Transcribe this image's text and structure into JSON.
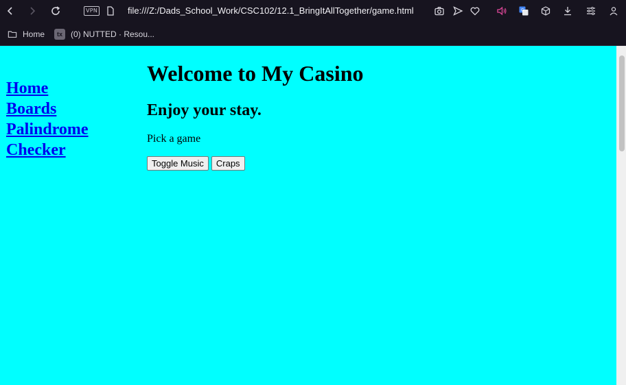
{
  "browser": {
    "vpn_label": "VPN",
    "url": "file:///Z:/Dads_School_Work/CSC102/12.1_BringItAllTogether/game.html",
    "bookmarks": [
      {
        "label": "Home",
        "icon": "folder-icon"
      },
      {
        "label": "(0) NUTTED · Resou...",
        "icon": "tx-favicon",
        "favicon_text": "tx"
      }
    ]
  },
  "page": {
    "background": "#00ffff",
    "nav_links": [
      "Home",
      "Boards",
      "Palindrome",
      "Checker"
    ],
    "title": "Welcome to My Casino",
    "subtitle": "Enjoy your stay.",
    "prompt": "Pick a game",
    "buttons": {
      "toggle_music": "Toggle Music",
      "craps": "Craps"
    }
  }
}
